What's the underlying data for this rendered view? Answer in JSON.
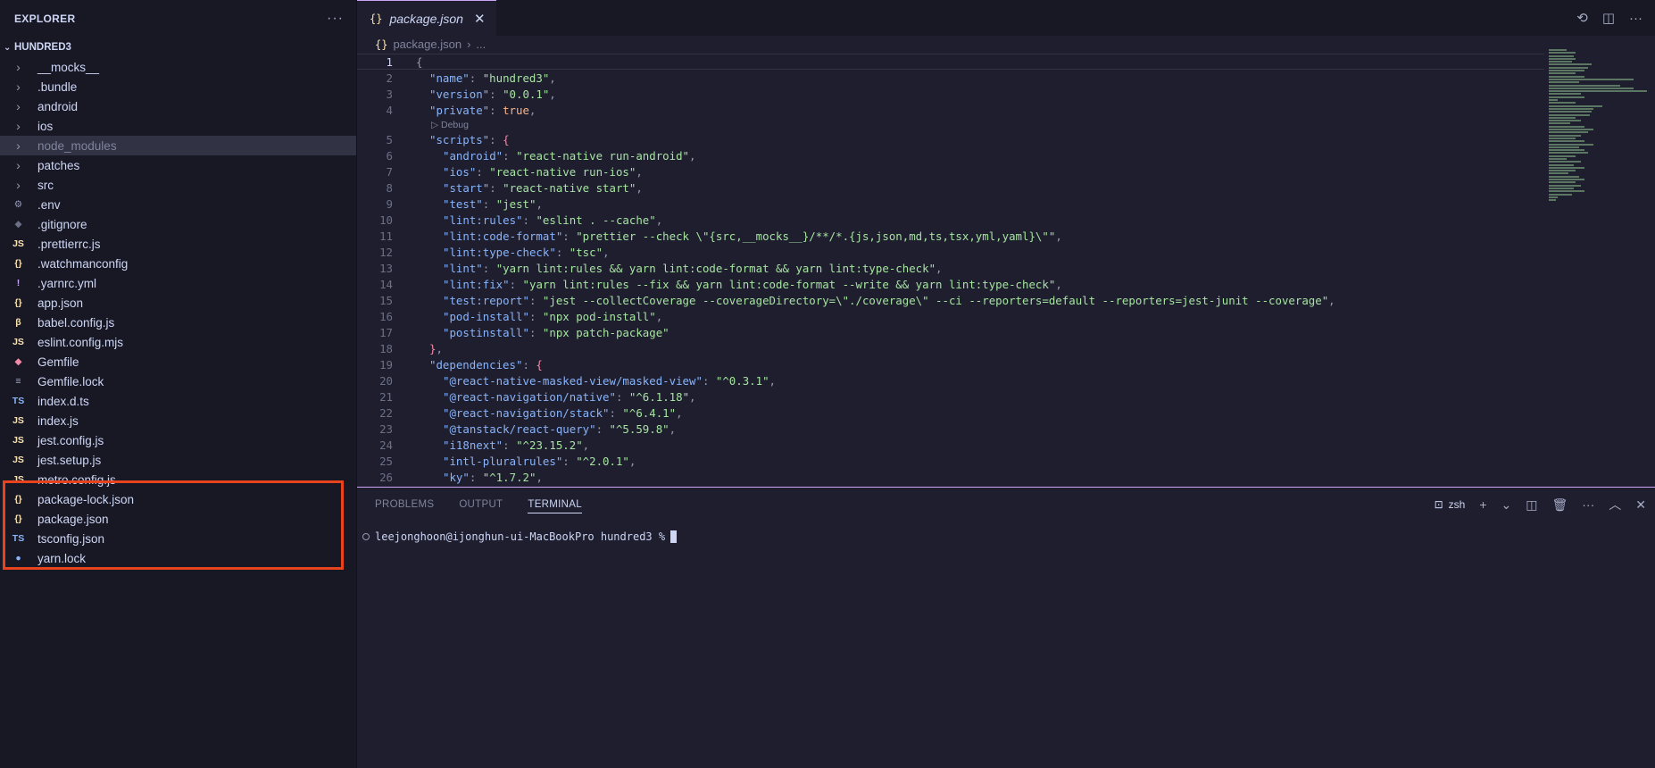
{
  "sidebar": {
    "title": "EXPLORER",
    "more": "···",
    "project": "HUNDRED3",
    "items": [
      {
        "name": "__mocks__",
        "type": "folder",
        "icon": "chevron-right-icon",
        "glyph": "›",
        "color": "#9399b2"
      },
      {
        "name": ".bundle",
        "type": "folder",
        "icon": "chevron-right-icon",
        "glyph": "›",
        "color": "#9399b2"
      },
      {
        "name": "android",
        "type": "folder",
        "icon": "chevron-right-icon",
        "glyph": "›",
        "color": "#9399b2"
      },
      {
        "name": "ios",
        "type": "folder",
        "icon": "chevron-right-icon",
        "glyph": "›",
        "color": "#9399b2"
      },
      {
        "name": "node_modules",
        "type": "folder",
        "icon": "chevron-right-icon",
        "glyph": "›",
        "color": "#9399b2",
        "selected": true,
        "dimmed": true
      },
      {
        "name": "patches",
        "type": "folder",
        "icon": "chevron-right-icon",
        "glyph": "›",
        "color": "#9399b2"
      },
      {
        "name": "src",
        "type": "folder",
        "icon": "chevron-right-icon",
        "glyph": "›",
        "color": "#9399b2"
      },
      {
        "name": ".env",
        "type": "file",
        "icon": "gear-icon",
        "glyph": "⚙",
        "color": "#9399b2"
      },
      {
        "name": ".gitignore",
        "type": "file",
        "icon": "git-icon",
        "glyph": "◆",
        "color": "#6c7086"
      },
      {
        "name": ".prettierrc.js",
        "type": "file",
        "icon": "js-icon",
        "glyph": "JS",
        "color": "#f9e2af"
      },
      {
        "name": ".watchmanconfig",
        "type": "file",
        "icon": "json-icon",
        "glyph": "{}",
        "color": "#f9e2af"
      },
      {
        "name": ".yarnrc.yml",
        "type": "file",
        "icon": "yaml-icon",
        "glyph": "!",
        "color": "#cba6f7"
      },
      {
        "name": "app.json",
        "type": "file",
        "icon": "json-icon",
        "glyph": "{}",
        "color": "#f9e2af"
      },
      {
        "name": "babel.config.js",
        "type": "file",
        "icon": "babel-icon",
        "glyph": "β",
        "color": "#f9e2af"
      },
      {
        "name": "eslint.config.mjs",
        "type": "file",
        "icon": "js-icon",
        "glyph": "JS",
        "color": "#f9e2af"
      },
      {
        "name": "Gemfile",
        "type": "file",
        "icon": "ruby-icon",
        "glyph": "◆",
        "color": "#f38ba8"
      },
      {
        "name": "Gemfile.lock",
        "type": "file",
        "icon": "lock-file-icon",
        "glyph": "≡",
        "color": "#a6adc8"
      },
      {
        "name": "index.d.ts",
        "type": "file",
        "icon": "ts-icon",
        "glyph": "TS",
        "color": "#89b4fa"
      },
      {
        "name": "index.js",
        "type": "file",
        "icon": "js-icon",
        "glyph": "JS",
        "color": "#f9e2af"
      },
      {
        "name": "jest.config.js",
        "type": "file",
        "icon": "js-icon",
        "glyph": "JS",
        "color": "#f9e2af"
      },
      {
        "name": "jest.setup.js",
        "type": "file",
        "icon": "js-icon",
        "glyph": "JS",
        "color": "#f9e2af"
      },
      {
        "name": "metro.config.js",
        "type": "file",
        "icon": "js-icon",
        "glyph": "JS",
        "color": "#f9e2af"
      },
      {
        "name": "package-lock.json",
        "type": "file",
        "icon": "json-icon",
        "glyph": "{}",
        "color": "#f9e2af"
      },
      {
        "name": "package.json",
        "type": "file",
        "icon": "json-icon",
        "glyph": "{}",
        "color": "#f9e2af"
      },
      {
        "name": "tsconfig.json",
        "type": "file",
        "icon": "tsconfig-icon",
        "glyph": "TS",
        "color": "#89b4fa"
      },
      {
        "name": "yarn.lock",
        "type": "file",
        "icon": "yarn-icon",
        "glyph": "●",
        "color": "#89b4fa"
      }
    ]
  },
  "editor": {
    "tab": {
      "label": "package.json",
      "icon": "json-icon",
      "glyph": "{}",
      "close": "✕"
    },
    "actions": [
      {
        "name": "timeline-icon",
        "glyph": "⟲"
      },
      {
        "name": "split-editor-icon",
        "glyph": "◫"
      },
      {
        "name": "more-actions-icon",
        "glyph": "···"
      }
    ],
    "breadcrumb": {
      "file": "package.json",
      "sep": "›",
      "rest": "..."
    },
    "codelens": "▷ Debug",
    "lines": [
      {
        "n": 1,
        "tokens": [
          [
            "pun",
            "{"
          ]
        ]
      },
      {
        "n": 2,
        "indent": 1,
        "tokens": [
          [
            "k",
            "\"name\""
          ],
          [
            "pun",
            ": "
          ],
          [
            "s",
            "\"hundred3\""
          ],
          [
            "pun",
            ","
          ]
        ]
      },
      {
        "n": 3,
        "indent": 1,
        "tokens": [
          [
            "k",
            "\"version\""
          ],
          [
            "pun",
            ": "
          ],
          [
            "s",
            "\"0.0.1\""
          ],
          [
            "pun",
            ","
          ]
        ]
      },
      {
        "n": 4,
        "indent": 1,
        "tokens": [
          [
            "k",
            "\"private\""
          ],
          [
            "pun",
            ": "
          ],
          [
            "b",
            "true"
          ],
          [
            "pun",
            ","
          ]
        ]
      },
      {
        "n": 5,
        "indent": 1,
        "tokens": [
          [
            "k",
            "\"scripts\""
          ],
          [
            "pun",
            ": "
          ],
          [
            "p",
            "{"
          ]
        ]
      },
      {
        "n": 6,
        "indent": 2,
        "tokens": [
          [
            "k",
            "\"android\""
          ],
          [
            "pun",
            ": "
          ],
          [
            "s",
            "\"react-native run-android\""
          ],
          [
            "pun",
            ","
          ]
        ]
      },
      {
        "n": 7,
        "indent": 2,
        "tokens": [
          [
            "k",
            "\"ios\""
          ],
          [
            "pun",
            ": "
          ],
          [
            "s",
            "\"react-native run-ios\""
          ],
          [
            "pun",
            ","
          ]
        ]
      },
      {
        "n": 8,
        "indent": 2,
        "tokens": [
          [
            "k",
            "\"start\""
          ],
          [
            "pun",
            ": "
          ],
          [
            "s",
            "\"react-native start\""
          ],
          [
            "pun",
            ","
          ]
        ]
      },
      {
        "n": 9,
        "indent": 2,
        "tokens": [
          [
            "k",
            "\"test\""
          ],
          [
            "pun",
            ": "
          ],
          [
            "s",
            "\"jest\""
          ],
          [
            "pun",
            ","
          ]
        ]
      },
      {
        "n": 10,
        "indent": 2,
        "tokens": [
          [
            "k",
            "\"lint:rules\""
          ],
          [
            "pun",
            ": "
          ],
          [
            "s",
            "\"eslint . --cache\""
          ],
          [
            "pun",
            ","
          ]
        ]
      },
      {
        "n": 11,
        "indent": 2,
        "tokens": [
          [
            "k",
            "\"lint:code-format\""
          ],
          [
            "pun",
            ": "
          ],
          [
            "s",
            "\"prettier --check \\\"{src,__mocks__}/**/*.{js,json,md,ts,tsx,yml,yaml}\\\"\""
          ],
          [
            "pun",
            ","
          ]
        ]
      },
      {
        "n": 12,
        "indent": 2,
        "tokens": [
          [
            "k",
            "\"lint:type-check\""
          ],
          [
            "pun",
            ": "
          ],
          [
            "s",
            "\"tsc\""
          ],
          [
            "pun",
            ","
          ]
        ]
      },
      {
        "n": 13,
        "indent": 2,
        "tokens": [
          [
            "k",
            "\"lint\""
          ],
          [
            "pun",
            ": "
          ],
          [
            "s",
            "\"yarn lint:rules && yarn lint:code-format && yarn lint:type-check\""
          ],
          [
            "pun",
            ","
          ]
        ]
      },
      {
        "n": 14,
        "indent": 2,
        "tokens": [
          [
            "k",
            "\"lint:fix\""
          ],
          [
            "pun",
            ": "
          ],
          [
            "s",
            "\"yarn lint:rules --fix && yarn lint:code-format --write && yarn lint:type-check\""
          ],
          [
            "pun",
            ","
          ]
        ]
      },
      {
        "n": 15,
        "indent": 2,
        "tokens": [
          [
            "k",
            "\"test:report\""
          ],
          [
            "pun",
            ": "
          ],
          [
            "s",
            "\"jest --collectCoverage --coverageDirectory=\\\"./coverage\\\" --ci --reporters=default --reporters=jest-junit --coverage\""
          ],
          [
            "pun",
            ","
          ]
        ]
      },
      {
        "n": 16,
        "indent": 2,
        "tokens": [
          [
            "k",
            "\"pod-install\""
          ],
          [
            "pun",
            ": "
          ],
          [
            "s",
            "\"npx pod-install\""
          ],
          [
            "pun",
            ","
          ]
        ]
      },
      {
        "n": 17,
        "indent": 2,
        "tokens": [
          [
            "k",
            "\"postinstall\""
          ],
          [
            "pun",
            ": "
          ],
          [
            "s",
            "\"npx patch-package\""
          ]
        ]
      },
      {
        "n": 18,
        "indent": 1,
        "tokens": [
          [
            "p",
            "}"
          ],
          [
            "pun",
            ","
          ]
        ]
      },
      {
        "n": 19,
        "indent": 1,
        "tokens": [
          [
            "k",
            "\"dependencies\""
          ],
          [
            "pun",
            ": "
          ],
          [
            "p",
            "{"
          ]
        ]
      },
      {
        "n": 20,
        "indent": 2,
        "tokens": [
          [
            "k",
            "\"@react-native-masked-view/masked-view\""
          ],
          [
            "pun",
            ": "
          ],
          [
            "s",
            "\"^0.3.1\""
          ],
          [
            "pun",
            ","
          ]
        ]
      },
      {
        "n": 21,
        "indent": 2,
        "tokens": [
          [
            "k",
            "\"@react-navigation/native\""
          ],
          [
            "pun",
            ": "
          ],
          [
            "s",
            "\"^6.1.18\""
          ],
          [
            "pun",
            ","
          ]
        ]
      },
      {
        "n": 22,
        "indent": 2,
        "tokens": [
          [
            "k",
            "\"@react-navigation/stack\""
          ],
          [
            "pun",
            ": "
          ],
          [
            "s",
            "\"^6.4.1\""
          ],
          [
            "pun",
            ","
          ]
        ]
      },
      {
        "n": 23,
        "indent": 2,
        "tokens": [
          [
            "k",
            "\"@tanstack/react-query\""
          ],
          [
            "pun",
            ": "
          ],
          [
            "s",
            "\"^5.59.8\""
          ],
          [
            "pun",
            ","
          ]
        ]
      },
      {
        "n": 24,
        "indent": 2,
        "tokens": [
          [
            "k",
            "\"i18next\""
          ],
          [
            "pun",
            ": "
          ],
          [
            "s",
            "\"^23.15.2\""
          ],
          [
            "pun",
            ","
          ]
        ]
      },
      {
        "n": 25,
        "indent": 2,
        "tokens": [
          [
            "k",
            "\"intl-pluralrules\""
          ],
          [
            "pun",
            ": "
          ],
          [
            "s",
            "\"^2.0.1\""
          ],
          [
            "pun",
            ","
          ]
        ]
      },
      {
        "n": 26,
        "indent": 2,
        "tokens": [
          [
            "k",
            "\"ky\""
          ],
          [
            "pun",
            ": "
          ],
          [
            "s",
            "\"^1.7.2\""
          ],
          [
            "pun",
            ","
          ]
        ]
      }
    ]
  },
  "panel": {
    "tabs": [
      {
        "label": "PROBLEMS",
        "active": false
      },
      {
        "label": "OUTPUT",
        "active": false
      },
      {
        "label": "TERMINAL",
        "active": true
      }
    ],
    "shell": "zsh",
    "actions": [
      {
        "name": "new-terminal-icon",
        "glyph": "+"
      },
      {
        "name": "chevron-down-icon",
        "glyph": "⌄"
      },
      {
        "name": "split-terminal-icon",
        "glyph": "◫"
      },
      {
        "name": "trash-icon",
        "glyph": "🗑"
      },
      {
        "name": "more-actions-icon",
        "glyph": "···"
      },
      {
        "name": "maximize-panel-icon",
        "glyph": "︿"
      },
      {
        "name": "close-panel-icon",
        "glyph": "✕"
      }
    ],
    "prompt": "leejonghoon@ijonghun-ui-MacBookPro hundred3 %"
  }
}
